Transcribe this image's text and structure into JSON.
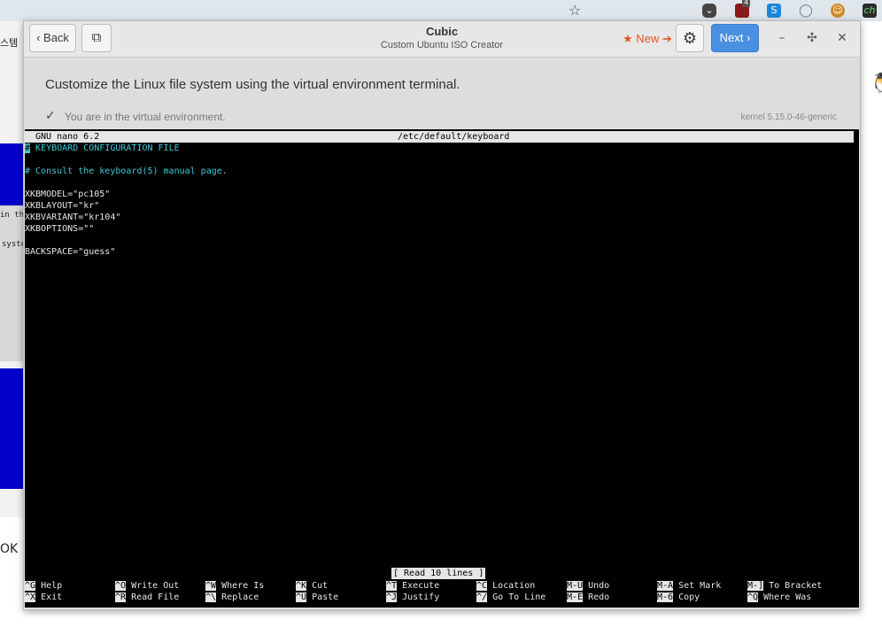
{
  "window": {
    "title": "Cubic",
    "subtitle": "Custom Ubuntu ISO Creator",
    "back_label": "Back",
    "new_label": "★ New ➔",
    "next_label": "Next",
    "instruction": "Customize the Linux file system using the virtual environment terminal.",
    "status": "You are in the virtual environment.",
    "kernel": "kernel 5.15.0-46-generic"
  },
  "background": {
    "left_text_1": "스템",
    "left_text_2": "in the",
    "left_text_3": "syste",
    "left_text_4": "OK",
    "ext_badge": "4"
  },
  "nano": {
    "version": "GNU nano 6.2",
    "file": "/etc/default/keyboard",
    "cursor_char": "#",
    "line1_rest": " KEYBOARD CONFIGURATION FILE",
    "line3": "# Consult the keyboard(5) manual page.",
    "line5": "XKBMODEL=\"pc105\"",
    "line6": "XKBLAYOUT=\"kr\"",
    "line7": "XKBVARIANT=\"kr104\"",
    "line8": "XKBOPTIONS=\"\"",
    "line10": "BACKSPACE=\"guess\"",
    "read_status": "[ Read 10 lines ]",
    "shortcuts_row1": [
      {
        "key": "^G",
        "label": "Help"
      },
      {
        "key": "^O",
        "label": "Write Out"
      },
      {
        "key": "^W",
        "label": "Where Is"
      },
      {
        "key": "^K",
        "label": "Cut"
      },
      {
        "key": "^T",
        "label": "Execute"
      },
      {
        "key": "^C",
        "label": "Location"
      },
      {
        "key": "M-U",
        "label": "Undo"
      },
      {
        "key": "M-A",
        "label": "Set Mark"
      },
      {
        "key": "M-]",
        "label": "To Bracket"
      }
    ],
    "shortcuts_row2": [
      {
        "key": "^X",
        "label": "Exit"
      },
      {
        "key": "^R",
        "label": "Read File"
      },
      {
        "key": "^\\",
        "label": "Replace"
      },
      {
        "key": "^U",
        "label": "Paste"
      },
      {
        "key": "^J",
        "label": "Justify"
      },
      {
        "key": "^/",
        "label": "Go To Line"
      },
      {
        "key": "M-E",
        "label": "Redo"
      },
      {
        "key": "M-6",
        "label": "Copy"
      },
      {
        "key": "^Q",
        "label": "Where Was"
      }
    ]
  }
}
